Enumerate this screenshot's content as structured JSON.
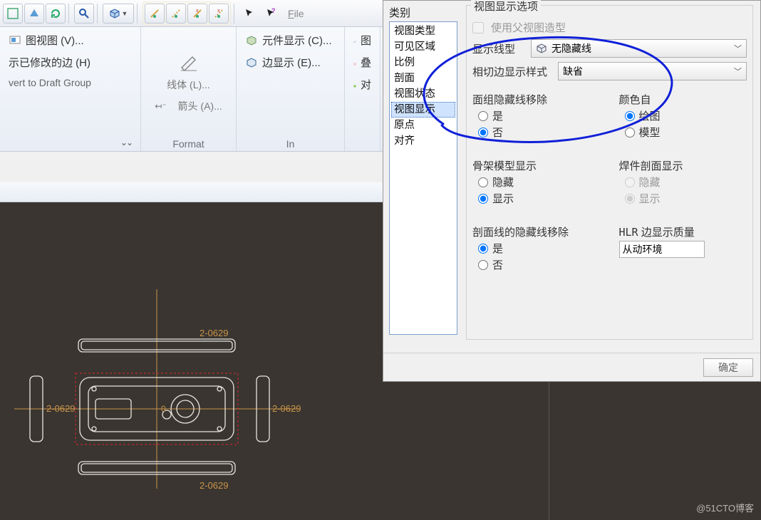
{
  "toolbar": {
    "file_menu": "File"
  },
  "ribbon": {
    "panel1": {
      "item1": "图视图 (V)...",
      "item2": "示已修改的边 (H)",
      "item3": "vert to Draft Group",
      "title": ""
    },
    "panel2": {
      "item1": "线体 (L)...",
      "item2": "箭头 (A)...",
      "title": "Format"
    },
    "panel3": {
      "item1": "元件显示 (C)...",
      "item2": "边显示 (E)...",
      "title": "In"
    },
    "panel4": {
      "item1": "图",
      "item2": "叠",
      "item3": "对"
    }
  },
  "cad": {
    "label1": "2-0629",
    "label2": "2-0629",
    "label3": "2-0629",
    "label4": "2-0629"
  },
  "dialog": {
    "categories_label": "类别",
    "categories": [
      "视图类型",
      "可见区域",
      "比例",
      "剖面",
      "视图状态",
      "视图显示",
      "原点",
      "对齐"
    ],
    "selected_index": 5,
    "group_title": "视图显示选项",
    "use_parent_label": "使用父视图造型",
    "line_type_label": "显示线型",
    "line_type_value": "无隐藏线",
    "tangent_label": "相切边显示样式",
    "tangent_value": "缺省",
    "facet_hidden_title": "面组隐藏线移除",
    "skel_title": "骨架模型显示",
    "section_hidden_title": "剖面线的隐藏线移除",
    "yes": "是",
    "no": "否",
    "hide": "隐藏",
    "show": "显示",
    "color_from_title": "颜色自",
    "color_draw": "绘图",
    "color_model": "模型",
    "weld_title": "焊件剖面显示",
    "hlr_label": "HLR 边显示质量",
    "hlr_value": "从动环境",
    "ok": "确定"
  },
  "watermark": "@51CTO博客"
}
